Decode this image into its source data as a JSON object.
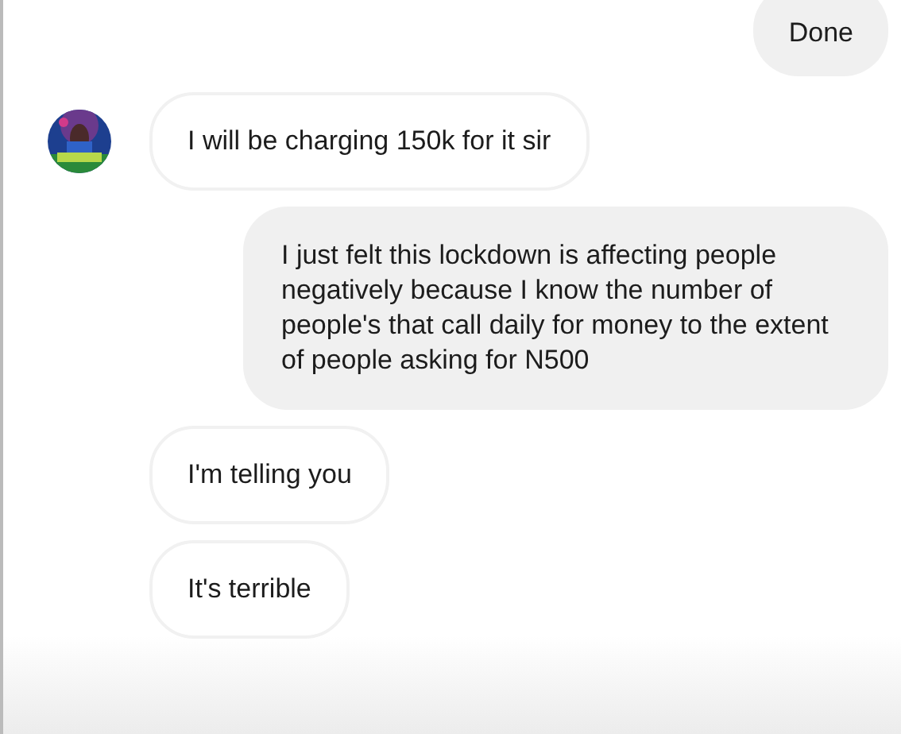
{
  "messages": [
    {
      "kind": "sent",
      "text": "Done",
      "avatar": false
    },
    {
      "kind": "received",
      "text": "I will be charging 150k for it sir",
      "avatar": true
    },
    {
      "kind": "sent",
      "text": "I just felt this lockdown is affecting people negatively because I know the number of people's that call daily for money to the extent of people asking for N500",
      "avatar": false
    },
    {
      "kind": "received",
      "text": "I'm telling you",
      "avatar": false
    },
    {
      "kind": "received",
      "text": "It's terrible",
      "avatar": false
    }
  ]
}
